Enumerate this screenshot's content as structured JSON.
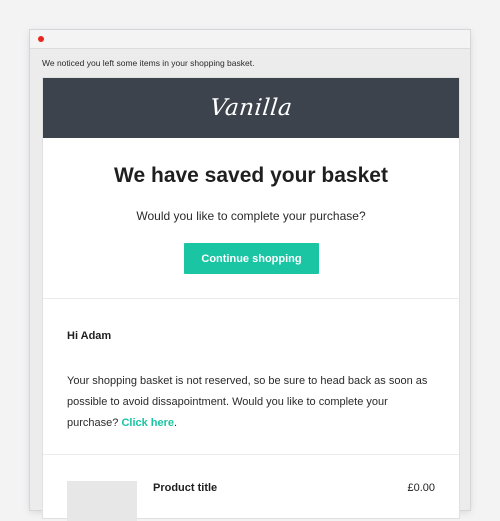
{
  "email": {
    "preheader": "We noticed you left some items in your shopping basket.",
    "brand": "Vanilla",
    "hero": {
      "title": "We have saved your basket",
      "subtitle": "Would you like to complete your purchase?",
      "cta_label": "Continue shopping"
    },
    "body": {
      "greeting": "Hi Adam",
      "message_text": "Your shopping basket is not reserved, so be sure to head back as soon as possible to avoid dissapointment. Would you like to complete your purchase?",
      "link_label": "Click here",
      "message_end": "."
    },
    "product": {
      "title": "Product title",
      "price": "£0.00"
    }
  },
  "colors": {
    "header_bg": "#3d434c",
    "accent": "#19c5a2",
    "window_close": "#e8261e"
  }
}
